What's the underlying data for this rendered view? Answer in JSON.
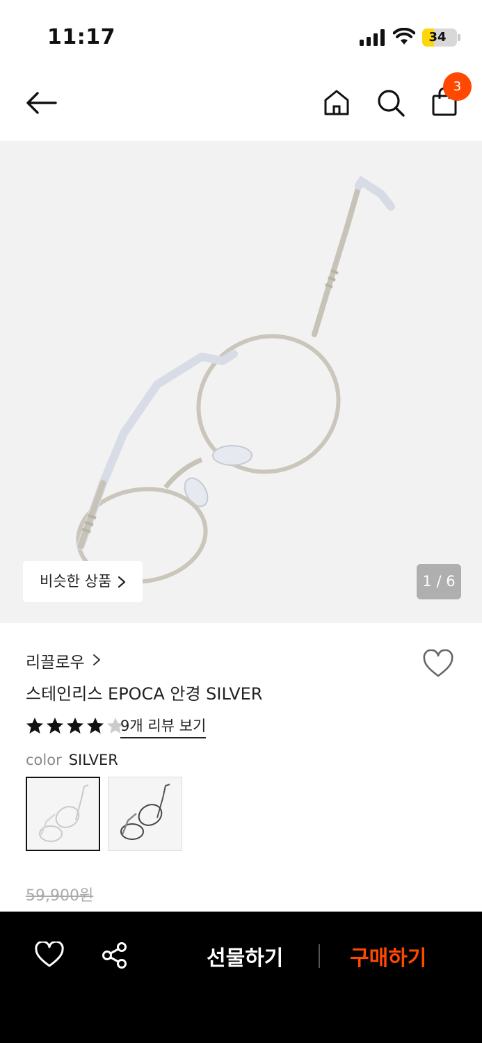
{
  "status_bar": {
    "time": "11:17",
    "battery": "34",
    "battery_level": 0.34
  },
  "header": {
    "cart_count": "3"
  },
  "hero": {
    "similar_label": "비슷한 상품",
    "page_indicator": "1 / 6"
  },
  "product": {
    "brand": "리끌로우",
    "title": "스테인리스 EPOCA 안경 SILVER",
    "rating": 4,
    "rating_max": 5,
    "review_link": "9개 리뷰 보기",
    "color_label": "color",
    "color_value": "SILVER",
    "original_price": "59,900원"
  },
  "bottom_bar": {
    "gift_label": "선물하기",
    "buy_label": "구매하기"
  },
  "colors": {
    "accent": "#ff4800",
    "star": "#111111",
    "star_empty": "#cccccc"
  },
  "icons": [
    "back-arrow-icon",
    "home-icon",
    "search-icon",
    "cart-icon",
    "heart-icon",
    "share-icon",
    "chevron-right-icon",
    "star-icon"
  ]
}
